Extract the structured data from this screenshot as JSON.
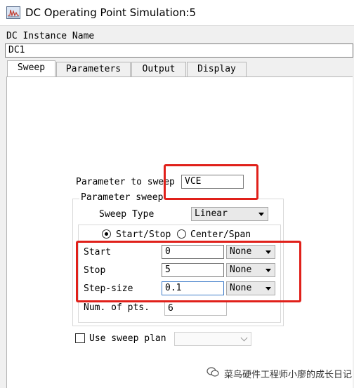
{
  "window": {
    "title": "DC Operating Point Simulation:5",
    "icon": "waveform-icon"
  },
  "instance": {
    "label": "DC Instance Name",
    "value": "DC1"
  },
  "tabs": [
    {
      "label": "Sweep",
      "active": true
    },
    {
      "label": "Parameters",
      "active": false
    },
    {
      "label": "Output",
      "active": false
    },
    {
      "label": "Display",
      "active": false
    }
  ],
  "sweep": {
    "param_label": "Parameter to sweep",
    "param_value": "VCE",
    "group_label": "Parameter sweep",
    "type_label": "Sweep Type",
    "type_value": "Linear",
    "radio_startstop": "Start/Stop",
    "radio_centerspan": "Center/Span",
    "selected_mode": "Start/Stop",
    "start_label": "Start",
    "start_value": "0",
    "start_unit": "None",
    "stop_label": "Stop",
    "stop_value": "5",
    "stop_unit": "None",
    "step_label": "Step-size",
    "step_value": "0.1",
    "step_unit": "None",
    "numpts_label": "Num. of pts.",
    "numpts_value": "6",
    "plan_label": "Use sweep plan",
    "plan_checked": false
  },
  "watermark": {
    "text": "菜鸟硬件工程师小廖的成长日记"
  },
  "colors": {
    "highlight": "#e0201a",
    "focus": "#3d7bc8"
  }
}
